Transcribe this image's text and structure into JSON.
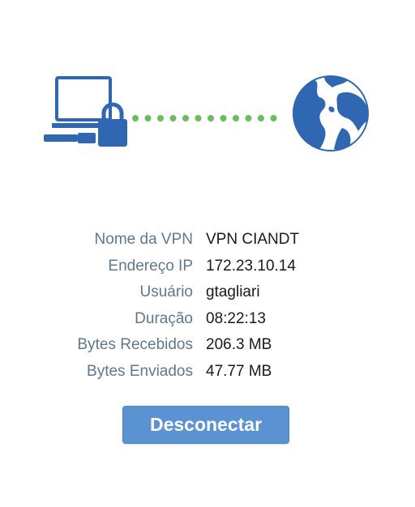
{
  "colors": {
    "icon_blue": "#2f67b2",
    "connection_green": "#6bbd5b",
    "label_gray": "#5f7891",
    "button_blue": "#5b92d2"
  },
  "icons": {
    "computer": "laptop-with-lock-icon",
    "connection": "dotted-connection-line",
    "internet": "globe-icon"
  },
  "vpn_info": [
    {
      "label": "Nome da VPN",
      "value": "VPN CIANDT"
    },
    {
      "label": "Endereço IP",
      "value": "172.23.10.14"
    },
    {
      "label": "Usuário",
      "value": "gtagliari"
    },
    {
      "label": "Duração",
      "value": "08:22:13"
    },
    {
      "label": "Bytes Recebidos",
      "value": "206.3 MB"
    },
    {
      "label": "Bytes Enviados",
      "value": "47.77 MB"
    }
  ],
  "actions": {
    "disconnect_label": "Desconectar"
  }
}
